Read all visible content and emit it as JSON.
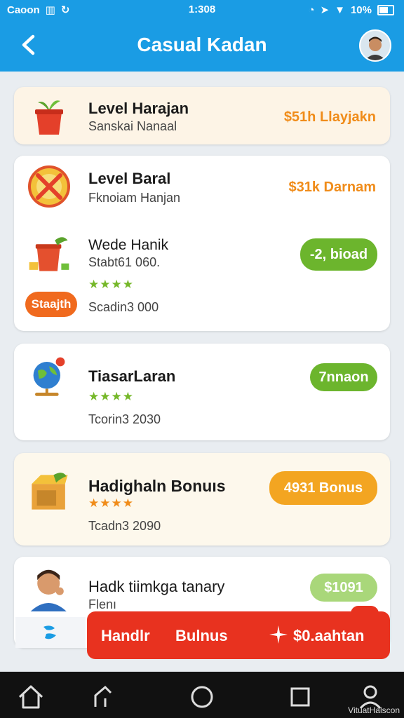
{
  "status_bar": {
    "carrier": "Caoon",
    "time": "1:308",
    "battery": "10%"
  },
  "header": {
    "title": "Casual Kadan"
  },
  "cards": [
    {
      "title": "Level Harajan",
      "subtitle": "Sanskai Nanaal",
      "prize": "$51h Llayjakn",
      "icon": "plant-bucket-icon"
    },
    {
      "title": "Level Baral",
      "subtitle": "Fknoiam Hanjan",
      "prize": "$31k Darnam",
      "icon": "wheel-no-icon",
      "sub_item": {
        "title": "Wede Hanik",
        "subtitle": "Stabt61 060.",
        "stars": "★★★★",
        "meta": "Scadin3 000",
        "tag": "Staajth",
        "button": "-2, bioad"
      }
    },
    {
      "title": "TiasarLaran",
      "stars": "★★★★",
      "meta": "Tcorin3 2030",
      "button": "7nnaon",
      "icon": "globe-icon"
    },
    {
      "title": "Hadighaln Bonuıs",
      "stars": "★★★★",
      "meta": "Tcadn3 2090",
      "button": "4931 Bonus",
      "icon": "treasure-box-icon"
    },
    {
      "title": "Hadk tiimkga tanary",
      "subtitle": "Flenı",
      "button": "$1091",
      "icon": "person-icon"
    }
  ],
  "action_bar": {
    "label_1": "Handlr",
    "label_2": "Bulnus",
    "label_3": "$0.aahtan"
  },
  "watermark": "VituatHalscon",
  "colors": {
    "primary_blue": "#1a9ce4",
    "accent_orange": "#f08c1a",
    "green": "#76b82a",
    "red": "#e8321f"
  }
}
